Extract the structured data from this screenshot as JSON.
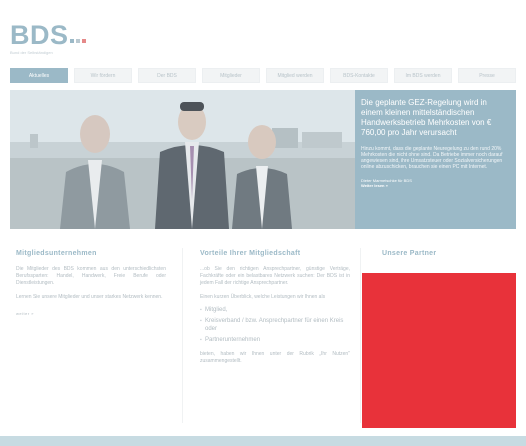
{
  "logo": {
    "text": "BDS",
    "subtitle": "Bund der Selbständigen",
    "colors": {
      "primary": "#9bb9c7",
      "accent": "#e58989"
    }
  },
  "nav": {
    "items": [
      {
        "label": "Aktuelles",
        "active": true
      },
      {
        "label": "Wir fördern",
        "active": false
      },
      {
        "label": "Der BDS",
        "active": false
      },
      {
        "label": "Mitglieder",
        "active": false
      },
      {
        "label": "Mitglied werden",
        "active": false
      },
      {
        "label": "BDS-Kontakte",
        "active": false
      },
      {
        "label": "Im BDS werden",
        "active": false
      },
      {
        "label": "Presse",
        "active": false
      }
    ]
  },
  "hero": {
    "image_alt": "three men in suits at a harbour",
    "headline": "Die geplante GEZ-Regelung wird in einem kleinen mittelständischen Handwerksbetrieb Mehrkosten von € 760,00 pro Jahr verursacht",
    "body": "Hinzu kommt, dass die geplante Neuregelung zu den rund 20% Mehrkosten die nicht ohne sind. Da Betriebe immer noch darauf angewiesen sind, ihre Umsatzsteuer oder Sozialversicherungen online abzuschicken, brauchen sie einen PC mit Internet.",
    "source": "Dieter Marmetschke für BDS",
    "more": "Weiter lesen »"
  },
  "columns": {
    "members": {
      "title": "Mitgliedsunternehmen",
      "p1": "Die Mitglieder des BDS kommen aus den unterschiedlichsten Berufssparten: Handel, Handwerk, Freie Berufe oder Dienstleistungen.",
      "p2": "Lernen Sie unsere Mitglieder und unser starkes Netzwerk kennen.",
      "more": "weiter »"
    },
    "benefits": {
      "title": "Vorteile Ihrer Mitgliedschaft",
      "p1": "...ob Sie den richtigen Ansprechpartner, günstige Verträge, Fachkräfte oder ein belastbares Netzwerk suchen: Der BDS ist in jedem Fall der richtige Ansprechpartner.",
      "p2": "Einen kurzen Überblick, welche Leistungen wir Ihnen als",
      "bullets": [
        "Mitglied,",
        "Kreisverband / bzw. Ansprechpartner für einen Kreis oder",
        "Partnerunternehmen"
      ],
      "p3": "bieten, haben wir Ihnen unter der Rubrik „Ihr Nutzen\" zusammengestellt."
    },
    "partners": {
      "title": "Unsere Partner",
      "box_color": "#e8323a"
    }
  }
}
